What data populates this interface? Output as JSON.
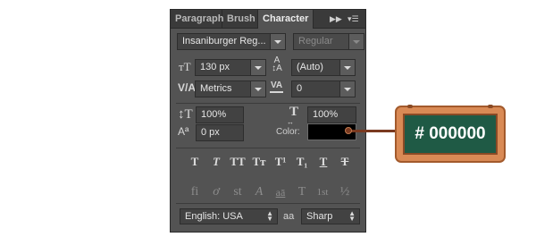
{
  "tabs": [
    {
      "label": "Paragraph"
    },
    {
      "label": "Brush"
    },
    {
      "label": "Character"
    }
  ],
  "font": {
    "family": "Insaniburger Reg...",
    "style": "Regular"
  },
  "size": {
    "value": "130 px"
  },
  "leading": {
    "value": "(Auto)"
  },
  "kerning": {
    "value": "Metrics"
  },
  "tracking": {
    "value": "0"
  },
  "vertical_scale": {
    "value": "100%"
  },
  "horizontal_scale": {
    "value": "100%"
  },
  "baseline_shift": {
    "value": "0 px"
  },
  "color": {
    "label": "Color:",
    "value": "#000000"
  },
  "style_buttons": [
    {
      "glyph": "T",
      "name": "faux-bold"
    },
    {
      "glyph": "T",
      "name": "faux-italic"
    },
    {
      "glyph": "TT",
      "name": "all-caps"
    },
    {
      "glyph": "Tт",
      "name": "small-caps"
    },
    {
      "glyph": "T¹",
      "name": "superscript"
    },
    {
      "glyph": "T₁",
      "name": "subscript"
    },
    {
      "glyph": "T",
      "name": "underline"
    },
    {
      "glyph": "T",
      "name": "strikethrough"
    }
  ],
  "opentype_buttons": [
    {
      "glyph": "fi",
      "name": "standard-ligatures"
    },
    {
      "glyph": "ơ",
      "name": "contextual-alternates"
    },
    {
      "glyph": "st",
      "name": "discretionary-ligatures"
    },
    {
      "glyph": "A",
      "name": "swash"
    },
    {
      "glyph": "aā",
      "name": "stylistic-alternates"
    },
    {
      "glyph": "T",
      "name": "titling-alternates"
    },
    {
      "glyph": "1st",
      "name": "ordinals"
    },
    {
      "glyph": "½",
      "name": "fractions"
    }
  ],
  "language": {
    "value": "English: USA"
  },
  "antialias": {
    "icon_text": "aa",
    "value": "Sharp"
  },
  "callout": {
    "text": "# 000000"
  },
  "colors": {
    "panel_bg": "#535353",
    "field_bg": "#424242",
    "board_wood": "#d98a55",
    "board_green": "#1f5a45",
    "swatch": "#000000"
  }
}
